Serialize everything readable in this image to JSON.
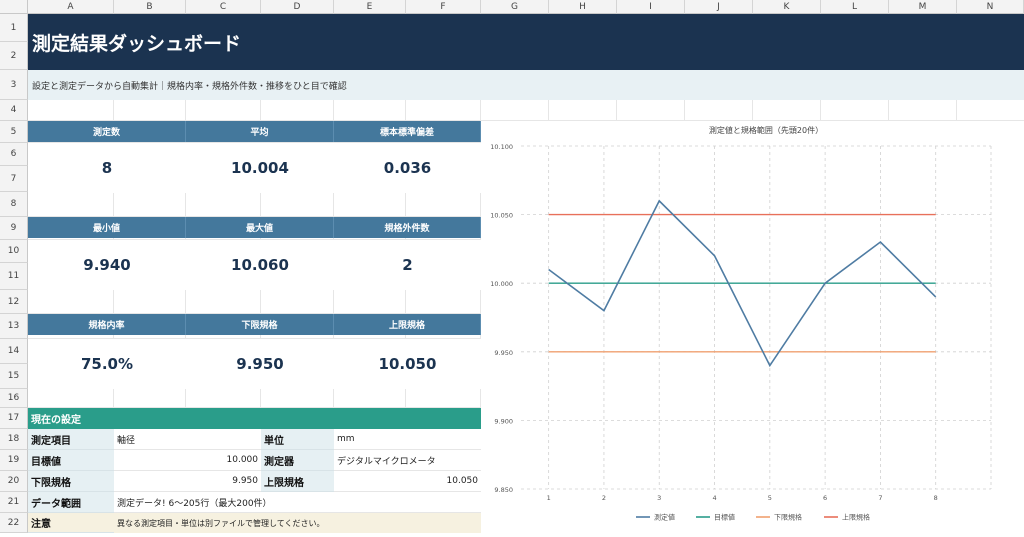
{
  "columns": [
    "A",
    "B",
    "C",
    "D",
    "E",
    "F",
    "G",
    "H",
    "I",
    "J",
    "K",
    "L",
    "M",
    "N"
  ],
  "rows": [
    "1",
    "2",
    "3",
    "4",
    "5",
    "6",
    "7",
    "8",
    "9",
    "10",
    "11",
    "12",
    "13",
    "14",
    "15",
    "16",
    "17",
    "18",
    "19",
    "20",
    "21",
    "22"
  ],
  "header": {
    "title": "測定結果ダッシュボード",
    "subtitle": "設定と測定データから自動集計｜規格内率・規格外件数・推移をひと目で確認"
  },
  "kpis": [
    {
      "label": "測定数",
      "value": "8"
    },
    {
      "label": "平均",
      "value": "10.004"
    },
    {
      "label": "標本標準偏差",
      "value": "0.036"
    },
    {
      "label": "最小値",
      "value": "9.940"
    },
    {
      "label": "最大値",
      "value": "10.060"
    },
    {
      "label": "規格外件数",
      "value": "2"
    },
    {
      "label": "規格内率",
      "value": "75.0%"
    },
    {
      "label": "下限規格",
      "value": "9.950"
    },
    {
      "label": "上限規格",
      "value": "10.050"
    }
  ],
  "settings": {
    "heading": "現在の設定",
    "item_label": "測定項目",
    "item_value": "軸径",
    "unit_label": "単位",
    "unit_value": "mm",
    "target_label": "目標値",
    "target_value": "10.000",
    "instrument_label": "測定器",
    "instrument_value": "デジタルマイクロメータ",
    "lower_label": "下限規格",
    "lower_value": "9.950",
    "upper_label": "上限規格",
    "upper_value": "10.050",
    "range_label": "データ範囲",
    "range_value": "測定データ! 6～205行（最大200件）",
    "note_label": "注意",
    "note_value": "異なる測定項目・単位は別ファイルで管理してください。"
  },
  "chart_data": {
    "type": "line",
    "title": "測定値と規格範囲（先頭20件）",
    "categories": [
      "1",
      "2",
      "3",
      "4",
      "5",
      "6",
      "7",
      "8"
    ],
    "ylim": [
      9.85,
      10.1
    ],
    "yticks": [
      "10.100",
      "10.050",
      "10.000",
      "9.950",
      "9.900",
      "9.850"
    ],
    "grid": true,
    "legend_position": "bottom",
    "series": [
      {
        "name": "測定値",
        "color": "#4f7ca3",
        "values": [
          10.01,
          9.98,
          10.06,
          10.02,
          9.94,
          10.0,
          10.03,
          9.99
        ]
      },
      {
        "name": "目標値",
        "color": "#2a9d8a",
        "values": [
          10.0,
          10.0,
          10.0,
          10.0,
          10.0,
          10.0,
          10.0,
          10.0
        ]
      },
      {
        "name": "下限規格",
        "color": "#f0a070",
        "values": [
          9.95,
          9.95,
          9.95,
          9.95,
          9.95,
          9.95,
          9.95,
          9.95
        ]
      },
      {
        "name": "上限規格",
        "color": "#e8705a",
        "values": [
          10.05,
          10.05,
          10.05,
          10.05,
          10.05,
          10.05,
          10.05,
          10.05
        ]
      }
    ]
  }
}
